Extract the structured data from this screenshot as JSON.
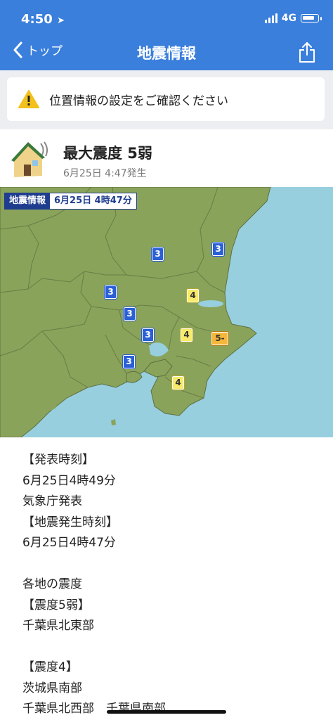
{
  "status_bar": {
    "time": "4:50",
    "network": "4G"
  },
  "nav": {
    "back_label": "トップ",
    "title": "地震情報"
  },
  "notice": {
    "text": "位置情報の設定をご確認ください"
  },
  "quake": {
    "title": "最大震度 5弱",
    "subtitle": "6月25日 4:47発生"
  },
  "map": {
    "label": "地震情報",
    "date": "6月25日 4時47分",
    "intensities": [
      "3",
      "3",
      "3",
      "3",
      "3",
      "3",
      "4",
      "4",
      "5-",
      "4"
    ]
  },
  "body_lines": [
    "【発表時刻】",
    "6月25日4時49分",
    "気象庁発表",
    "【地震発生時刻】",
    "6月25日4時47分",
    "",
    "各地の震度",
    "【震度5弱】",
    "千葉県北東部",
    "",
    "【震度4】",
    "茨城県南部",
    "千葉県北西部　千葉県南部"
  ],
  "colors": {
    "header": "#3b7fdc",
    "land": "#8aa35a",
    "sea": "#97cfdf",
    "shindo3": "#2a5fd6",
    "shindo4": "#f7eb6a",
    "shindo5lower": "#f5b73a"
  }
}
